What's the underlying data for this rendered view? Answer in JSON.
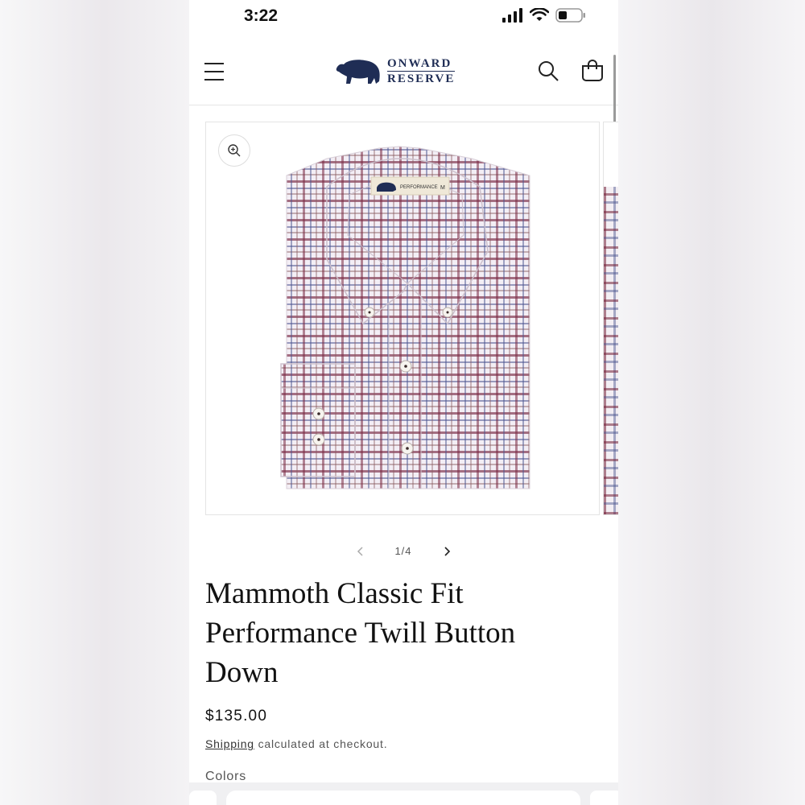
{
  "status_bar": {
    "time": "3:22"
  },
  "header": {
    "brand_line1": "ONWARD",
    "brand_line2": "RESERVE",
    "menu_icon": "hamburger-menu-icon",
    "search_icon": "search-icon",
    "cart_icon": "cart-icon"
  },
  "gallery": {
    "zoom_icon": "zoom-in-icon",
    "counter": "1/4",
    "shirt_label_brand": "PERFORMANCE",
    "shirt_label_size": "M",
    "colors": {
      "maroon": "#7a2a43",
      "navy": "#4a548f",
      "base": "#f3eef5"
    }
  },
  "product": {
    "title": "Mammoth Classic Fit Performance Twill Button Down",
    "price": "$135.00",
    "shipping_link": "Shipping",
    "shipping_rest": " calculated at checkout.",
    "colors_label": "Colors"
  }
}
